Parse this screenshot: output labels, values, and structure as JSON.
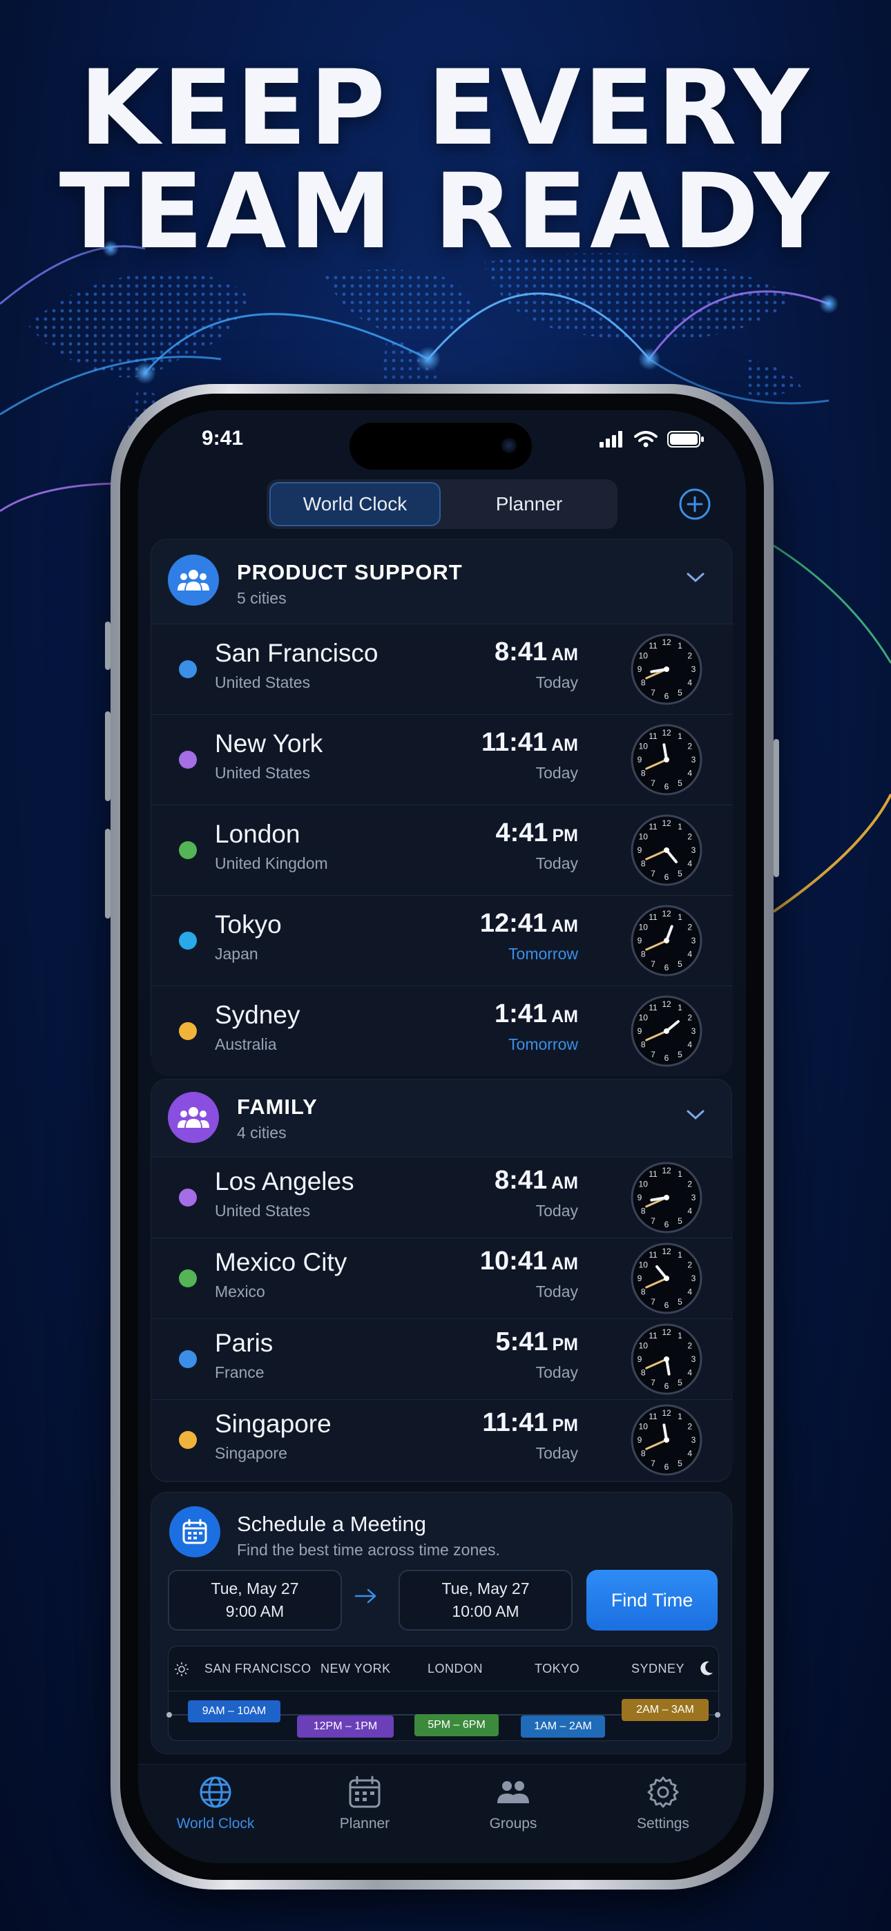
{
  "headline": {
    "line1": "KEEP EVERY",
    "line2": "TEAM READY"
  },
  "status_bar": {
    "time": "9:41",
    "icons": [
      "signal-icon",
      "wifi-icon",
      "battery-icon"
    ]
  },
  "segmented": {
    "world_clock": "World Clock",
    "planner": "Planner"
  },
  "groups": [
    {
      "title": "PRODUCT SUPPORT",
      "subtitle": "5 cities",
      "color": "#2f7fe6",
      "cities": [
        {
          "name": "San Francisco",
          "country": "United States",
          "time": "8:41",
          "ampm": "AM",
          "day": "Today",
          "dot": "#3b8fe6",
          "hour": 8,
          "minute": 41
        },
        {
          "name": "New York",
          "country": "United States",
          "time": "11:41",
          "ampm": "AM",
          "day": "Today",
          "dot": "#a56de6",
          "hour": 11,
          "minute": 41
        },
        {
          "name": "London",
          "country": "United Kingdom",
          "time": "4:41",
          "ampm": "PM",
          "day": "Today",
          "dot": "#55b455",
          "hour": 4,
          "minute": 41
        },
        {
          "name": "Tokyo",
          "country": "Japan",
          "time": "12:41",
          "ampm": "AM",
          "day": "Tomorrow",
          "dot": "#28a9e8",
          "hour": 12,
          "minute": 41
        },
        {
          "name": "Sydney",
          "country": "Australia",
          "time": "1:41",
          "ampm": "AM",
          "day": "Tomorrow",
          "dot": "#f0b43a",
          "hour": 1,
          "minute": 41
        }
      ]
    },
    {
      "title": "FAMILY",
      "subtitle": "4 cities",
      "color": "#8a4fe0",
      "cities": [
        {
          "name": "Los Angeles",
          "country": "United States",
          "time": "8:41",
          "ampm": "AM",
          "day": "Today",
          "dot": "#a56de6",
          "hour": 8,
          "minute": 41
        },
        {
          "name": "Mexico City",
          "country": "Mexico",
          "time": "10:41",
          "ampm": "AM",
          "day": "Today",
          "dot": "#55b455",
          "hour": 10,
          "minute": 41
        },
        {
          "name": "Paris",
          "country": "France",
          "time": "5:41",
          "ampm": "PM",
          "day": "Today",
          "dot": "#3b8fe6",
          "hour": 5,
          "minute": 41
        },
        {
          "name": "Singapore",
          "country": "Singapore",
          "time": "11:41",
          "ampm": "PM",
          "day": "Today",
          "dot": "#f0b43a",
          "hour": 11,
          "minute": 41
        }
      ]
    }
  ],
  "meeting": {
    "title": "Schedule a Meeting",
    "subtitle": "Find the best time across time zones.",
    "start": {
      "date": "Tue, May 27",
      "time": "9:00 AM"
    },
    "end": {
      "date": "Tue, May 27",
      "time": "10:00 AM"
    },
    "button": "Find Time",
    "timeline": {
      "cities": [
        "SAN FRANCISCO",
        "NEW YORK",
        "LONDON",
        "TOKYO",
        "SYDNEY"
      ],
      "slots": [
        {
          "label": "9AM – 10AM",
          "color": "#1e63c9"
        },
        {
          "label": "12PM – 1PM",
          "color": "#6a3fb8"
        },
        {
          "label": "5PM – 6PM",
          "color": "#3c8a3c"
        },
        {
          "label": "1AM – 2AM",
          "color": "#1f6bb8"
        },
        {
          "label": "2AM – 3AM",
          "color": "#9c7420"
        }
      ]
    }
  },
  "tabs": [
    {
      "label": "World Clock",
      "icon": "globe-icon",
      "active": true
    },
    {
      "label": "Planner",
      "icon": "calendar-icon",
      "active": false
    },
    {
      "label": "Groups",
      "icon": "people-icon",
      "active": false
    },
    {
      "label": "Settings",
      "icon": "gear-icon",
      "active": false
    }
  ],
  "colors": {
    "accent": "#3b8fe6",
    "tomorrow": "#3b8fe6"
  }
}
